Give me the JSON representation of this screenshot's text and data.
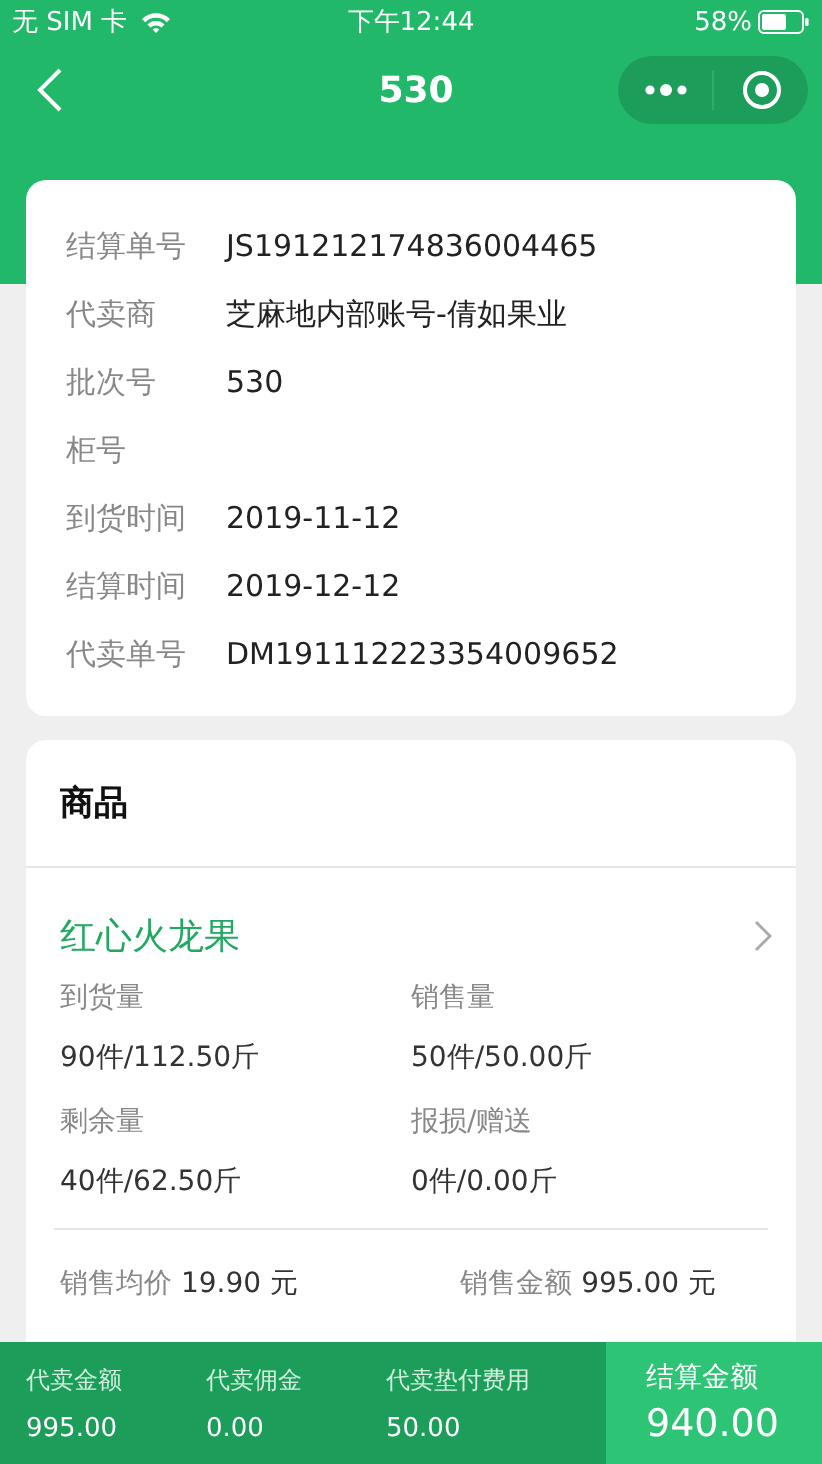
{
  "status_bar": {
    "carrier": "无 SIM 卡",
    "time": "下午12:44",
    "battery": "58%"
  },
  "nav": {
    "title": "530"
  },
  "info": [
    {
      "label": "结算单号",
      "value": "JS191212174836004465"
    },
    {
      "label": "代卖商",
      "value": "芝麻地内部账号-倩如果业"
    },
    {
      "label": "批次号",
      "value": "530"
    },
    {
      "label": "柜号"
    },
    {
      "label": "到货时间",
      "value": "2019-11-12"
    },
    {
      "label": "结算时间",
      "value": "2019-12-12"
    },
    {
      "label": "代卖单号",
      "value": "DM191112223354009652"
    }
  ],
  "goods": {
    "title": "商品",
    "product": {
      "name": "红心火龙果",
      "stats": [
        {
          "label": "到货量",
          "value": "90件/112.50斤"
        },
        {
          "label": "销售量",
          "value": "50件/50.00斤"
        },
        {
          "label": "剩余量",
          "value": "40件/62.50斤"
        },
        {
          "label": "报损/赠送",
          "value": "0件/0.00斤"
        }
      ],
      "summary": [
        {
          "label": "销售均价",
          "value": "19.90 元"
        },
        {
          "label": "销售金额",
          "value": "995.00 元"
        }
      ]
    }
  },
  "footer": {
    "items": [
      {
        "label": "代卖金额",
        "value": "995.00"
      },
      {
        "label": "代卖佣金",
        "value": "0.00"
      },
      {
        "label": "代卖垫付费用",
        "value": "50.00"
      }
    ],
    "total": {
      "label": "结算金额",
      "value": "940.00"
    }
  }
}
